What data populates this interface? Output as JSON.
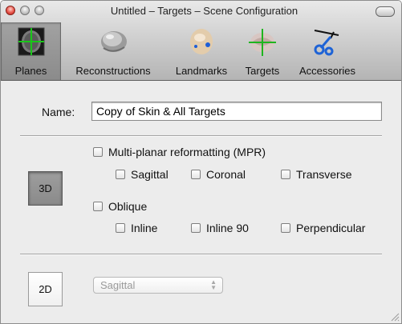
{
  "window": {
    "title": "Untitled – Targets – Scene Configuration"
  },
  "toolbar": {
    "items": [
      {
        "label": "Planes",
        "icon": "planes-icon",
        "selected": true
      },
      {
        "label": "Reconstructions",
        "icon": "reconstructions-icon",
        "selected": false
      },
      {
        "label": "Landmarks",
        "icon": "landmarks-icon",
        "selected": false
      },
      {
        "label": "Targets",
        "icon": "targets-icon",
        "selected": false
      },
      {
        "label": "Accessories",
        "icon": "accessories-icon",
        "selected": false
      }
    ]
  },
  "form": {
    "name_label": "Name:",
    "name_value": "Copy of Skin & All Targets"
  },
  "section3d": {
    "button_label": "3D",
    "button_pressed": true,
    "mpr": {
      "label": "Multi-planar reformatting (MPR)",
      "checked": false,
      "options": [
        {
          "label": "Sagittal",
          "checked": false
        },
        {
          "label": "Coronal",
          "checked": false
        },
        {
          "label": "Transverse",
          "checked": false
        }
      ]
    },
    "oblique": {
      "label": "Oblique",
      "checked": false,
      "options": [
        {
          "label": "Inline",
          "checked": false
        },
        {
          "label": "Inline 90",
          "checked": false
        },
        {
          "label": "Perpendicular",
          "checked": false
        }
      ]
    }
  },
  "section2d": {
    "button_label": "2D",
    "button_pressed": false,
    "popup_value": "Sagittal",
    "popup_enabled": false
  },
  "colors": {
    "toolbar_selected": "#8f8f8f",
    "content_bg": "#ececec",
    "close_button": "#e0443a"
  }
}
